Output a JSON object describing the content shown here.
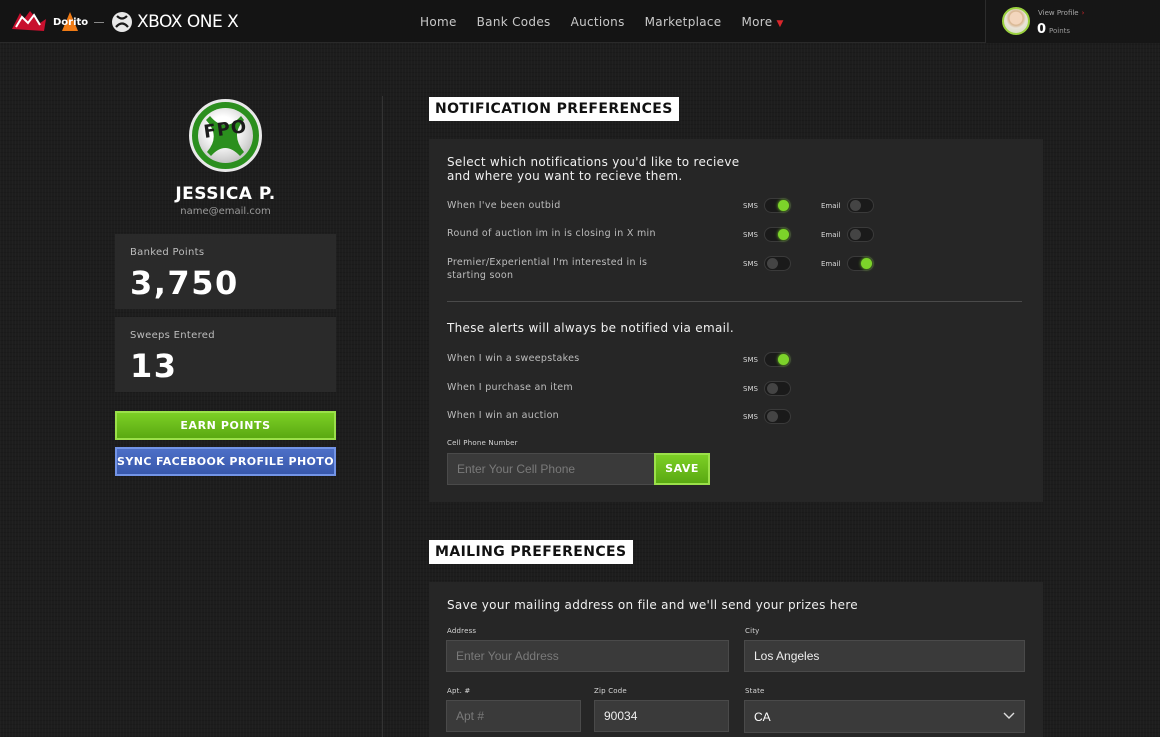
{
  "header": {
    "brand_text": "XBOX ONE X",
    "nav": [
      "Home",
      "Bank Codes",
      "Auctions",
      "Marketplace",
      "More"
    ],
    "view_profile": "View Profile",
    "points_value": "0",
    "points_label": "Points"
  },
  "user": {
    "avatar_text": "FPO",
    "name": "JESSICA P.",
    "email": "name@email.com",
    "banked_label": "Banked Points",
    "banked_value": "3,750",
    "sweeps_label": "Sweeps Entered",
    "sweeps_value": "13",
    "earn_btn": "EARN POINTS",
    "sync_btn": "SYNC FACEBOOK PROFILE PHOTO"
  },
  "notifications": {
    "title": "NOTIFICATION PREFERENCES",
    "intro_line1": "Select which notifications you'd like to recieve",
    "intro_line2": "and where you want to recieve them.",
    "sms_label": "SMS",
    "email_label": "Email",
    "rows": [
      {
        "label": "When I've been outbid",
        "sms": true,
        "email": false
      },
      {
        "label": "Round of auction im in is closing in X min",
        "sms": true,
        "email": false
      },
      {
        "label_line1": "Premier/Experiential I'm interested in is",
        "label_line2": "starting soon",
        "sms": false,
        "email": true
      }
    ],
    "always_title": "These alerts will always be notified via email.",
    "always_rows": [
      {
        "label": "When I win a sweepstakes",
        "sms": true
      },
      {
        "label": "When I purchase an item",
        "sms": false
      },
      {
        "label": "When I win an auction",
        "sms": false
      }
    ],
    "phone_label": "Cell Phone Number",
    "phone_placeholder": "Enter Your Cell Phone",
    "save_btn": "SAVE"
  },
  "mailing": {
    "title": "MAILING PREFERENCES",
    "intro": "Save your mailing address on file and we'll send your prizes here",
    "address_label": "Address",
    "address_placeholder": "Enter Your Address",
    "city_label": "City",
    "city_value": "Los Angeles",
    "apt_label": "Apt. #",
    "apt_placeholder": "Apt #",
    "zip_label": "Zip Code",
    "zip_value": "90034",
    "state_label": "State",
    "state_value": "CA"
  },
  "colors": {
    "accent_green": "#7cd32a",
    "facebook_blue": "#3f62b8",
    "more_caret_red": "#d9262b"
  }
}
